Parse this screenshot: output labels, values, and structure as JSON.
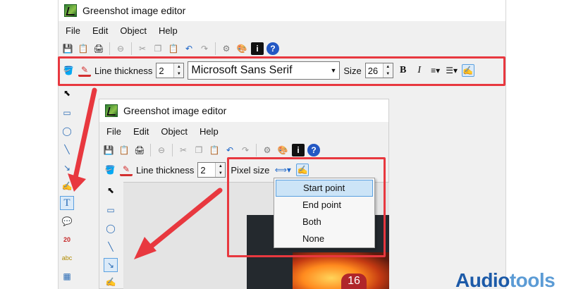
{
  "outer_window": {
    "title": "Greenshot image editor",
    "menu": [
      "File",
      "Edit",
      "Object",
      "Help"
    ],
    "propbar": {
      "line_thickness_label": "Line thickness",
      "line_thickness_value": "2",
      "font_name": "Microsoft Sans Serif",
      "size_label": "Size",
      "size_value": "26",
      "bold_label": "B",
      "italic_label": "I"
    }
  },
  "inner_window": {
    "title": "Greenshot image editor",
    "menu": [
      "File",
      "Edit",
      "Object",
      "Help"
    ],
    "propbar": {
      "line_thickness_label": "Line thickness",
      "line_thickness_value": "2",
      "pixel_size_label": "Pixel size"
    },
    "arrow_dropdown": {
      "items": [
        "Start point",
        "End point",
        "Both",
        "None"
      ],
      "selected": "Start point"
    },
    "image_badge": "16"
  },
  "logo": {
    "part1": "Audio",
    "part2": "tools"
  },
  "colors": {
    "highlight": "#e8383f",
    "menu_selection": "#cce4f7",
    "logo_dark": "#1c5aa8",
    "logo_light": "#5b9bd5"
  }
}
